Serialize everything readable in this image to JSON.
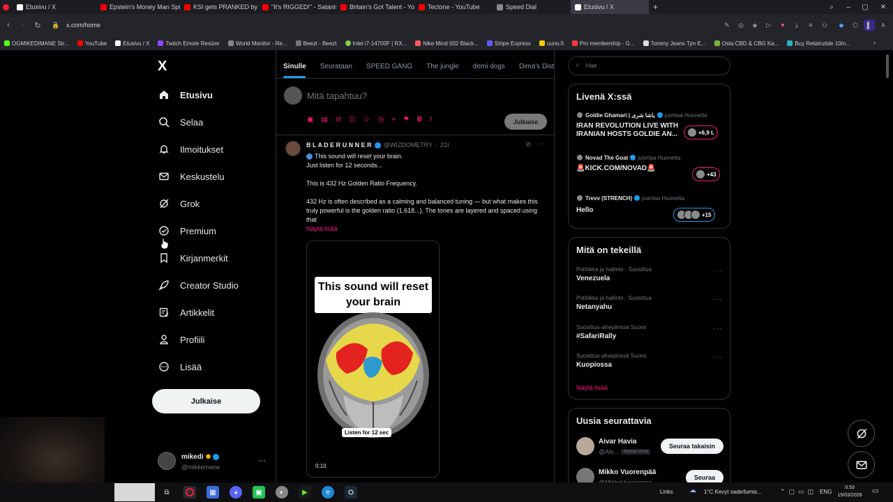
{
  "browser": {
    "tabs": [
      {
        "label": "Etusivu / X",
        "color": "#ffffff"
      },
      {
        "label": "Epstein's Money Man Spil",
        "color": "#ff0000"
      },
      {
        "label": "KSI gets PRANKED by bro",
        "color": "#ff0000"
      },
      {
        "label": "\"It's RIGGED!\" - Satanism",
        "color": "#ff0000"
      },
      {
        "label": "Britain's Got Talent - YouT",
        "color": "#ff0000"
      },
      {
        "label": "Tectone - YouTube",
        "color": "#ff0000"
      },
      {
        "label": "Speed Dial",
        "color": "#aaaaaa"
      },
      {
        "label": "Etusivu / X",
        "color": "#ffffff",
        "active": true
      }
    ],
    "url": "x.com/home",
    "bookmarks": [
      "OGMIKEDIMANE Str...",
      "YouTube",
      "Etusivu / X",
      "Twitch Emote Resizer",
      "World Monitor - Re...",
      "Beezt - Beezt",
      "Intel i7-14700F | RX...",
      "Nike Mind 002 Black...",
      "Stripe Express",
      "uuno.fi",
      "Pro membership - G...",
      "Tommy Jeans Tjm E...",
      "Osta CBD & CBG Ka...",
      "Buy Retatrutide 10m..."
    ]
  },
  "sidebar": {
    "logo": "X",
    "items": [
      {
        "label": "Etusivu",
        "icon": "home-icon"
      },
      {
        "label": "Selaa",
        "icon": "search-icon"
      },
      {
        "label": "Ilmoitukset",
        "icon": "bell-icon"
      },
      {
        "label": "Keskustelu",
        "icon": "mail-icon"
      },
      {
        "label": "Grok",
        "icon": "grok-icon"
      },
      {
        "label": "Premium",
        "icon": "premium-icon"
      },
      {
        "label": "Kirjanmerkit",
        "icon": "bookmark-icon"
      },
      {
        "label": "Creator Studio",
        "icon": "rocket-icon"
      },
      {
        "label": "Artikkelit",
        "icon": "article-icon"
      },
      {
        "label": "Profiili",
        "icon": "profile-icon"
      },
      {
        "label": "Lisää",
        "icon": "more-icon"
      }
    ],
    "post_button": "Julkaise",
    "account": {
      "name": "mikedi",
      "handle": "@mikkemane"
    }
  },
  "feed": {
    "tabs": [
      "Sinulle",
      "Seurataan",
      "SPEED GANG",
      "The jungle",
      "demi dogs",
      "Dima's Dist"
    ],
    "composer_placeholder": "Mitä tapahtuu?",
    "composer_post": "Julkaise",
    "post": {
      "author": "B L A D E R U N N E R",
      "handle": "@WIZDOMETRY",
      "time": "21t",
      "line1": "This sound will reset your brain.",
      "line2": "Just listen for 12 seconds...",
      "line3": "This is 432 Hz Golden Ratio Frequency.",
      "line4": "432 Hz is often described as a calming and balanced tuning — but what makes this truly powerful is the golden ratio (1.618...). The tones are layered and spaced using that",
      "show_more": "Näytä lisää",
      "media_title": "This sound will reset your brain",
      "media_caption": "Listen for 12 sec",
      "duration": "0:10"
    }
  },
  "right": {
    "search_placeholder": "Hae",
    "live": {
      "title": "Livenä X:ssä",
      "rows": [
        {
          "name": "Goldie Ghamari | یاشا شری",
          "sub": "juontaa Huonetta",
          "text": "IRAN REVOLUTION LIVE WITH IRANIAN HOSTS GOLDIE AN...",
          "count": "+6,9 t."
        },
        {
          "name": "Novad The Goat",
          "sub": "juontaa Huonetta",
          "text": "🚨KICK.COM/NOVAD🚨",
          "count": "+43"
        },
        {
          "name": "Trevv (STRENCH)",
          "sub": "juontaa Huonetta",
          "text": "Hello",
          "count": "+15"
        }
      ]
    },
    "trends": {
      "title": "Mitä on tekeillä",
      "items": [
        {
          "category": "Politiikka ja hallinto · Suosittua",
          "name": "Venezuela"
        },
        {
          "category": "Politiikka ja hallinto · Suosittua",
          "name": "Netanyahu"
        },
        {
          "category": "Suosittua aihepiirissä Suomi",
          "name": "#SafariRally"
        },
        {
          "category": "Suosittua aihepiirissä Suomi",
          "name": "Kuopiossa"
        }
      ],
      "show_more": "Näytä lisää"
    },
    "follow": {
      "title": "Uusia seurattavia",
      "people": [
        {
          "name": "Aivar Havia",
          "handle": "@Alv...",
          "note": "Seuraa sinua",
          "button": "Seuraa takaisin"
        },
        {
          "name": "Mikko Vuorenpää",
          "handle": "@MikkoVuorenpaa",
          "button": "Seuraa"
        }
      ]
    }
  },
  "taskbar": {
    "links": "Links",
    "weather": "1°C  Kevyt sade/lumis...",
    "lang": "ENG",
    "time": "0.53",
    "date": "15/03/2026"
  }
}
